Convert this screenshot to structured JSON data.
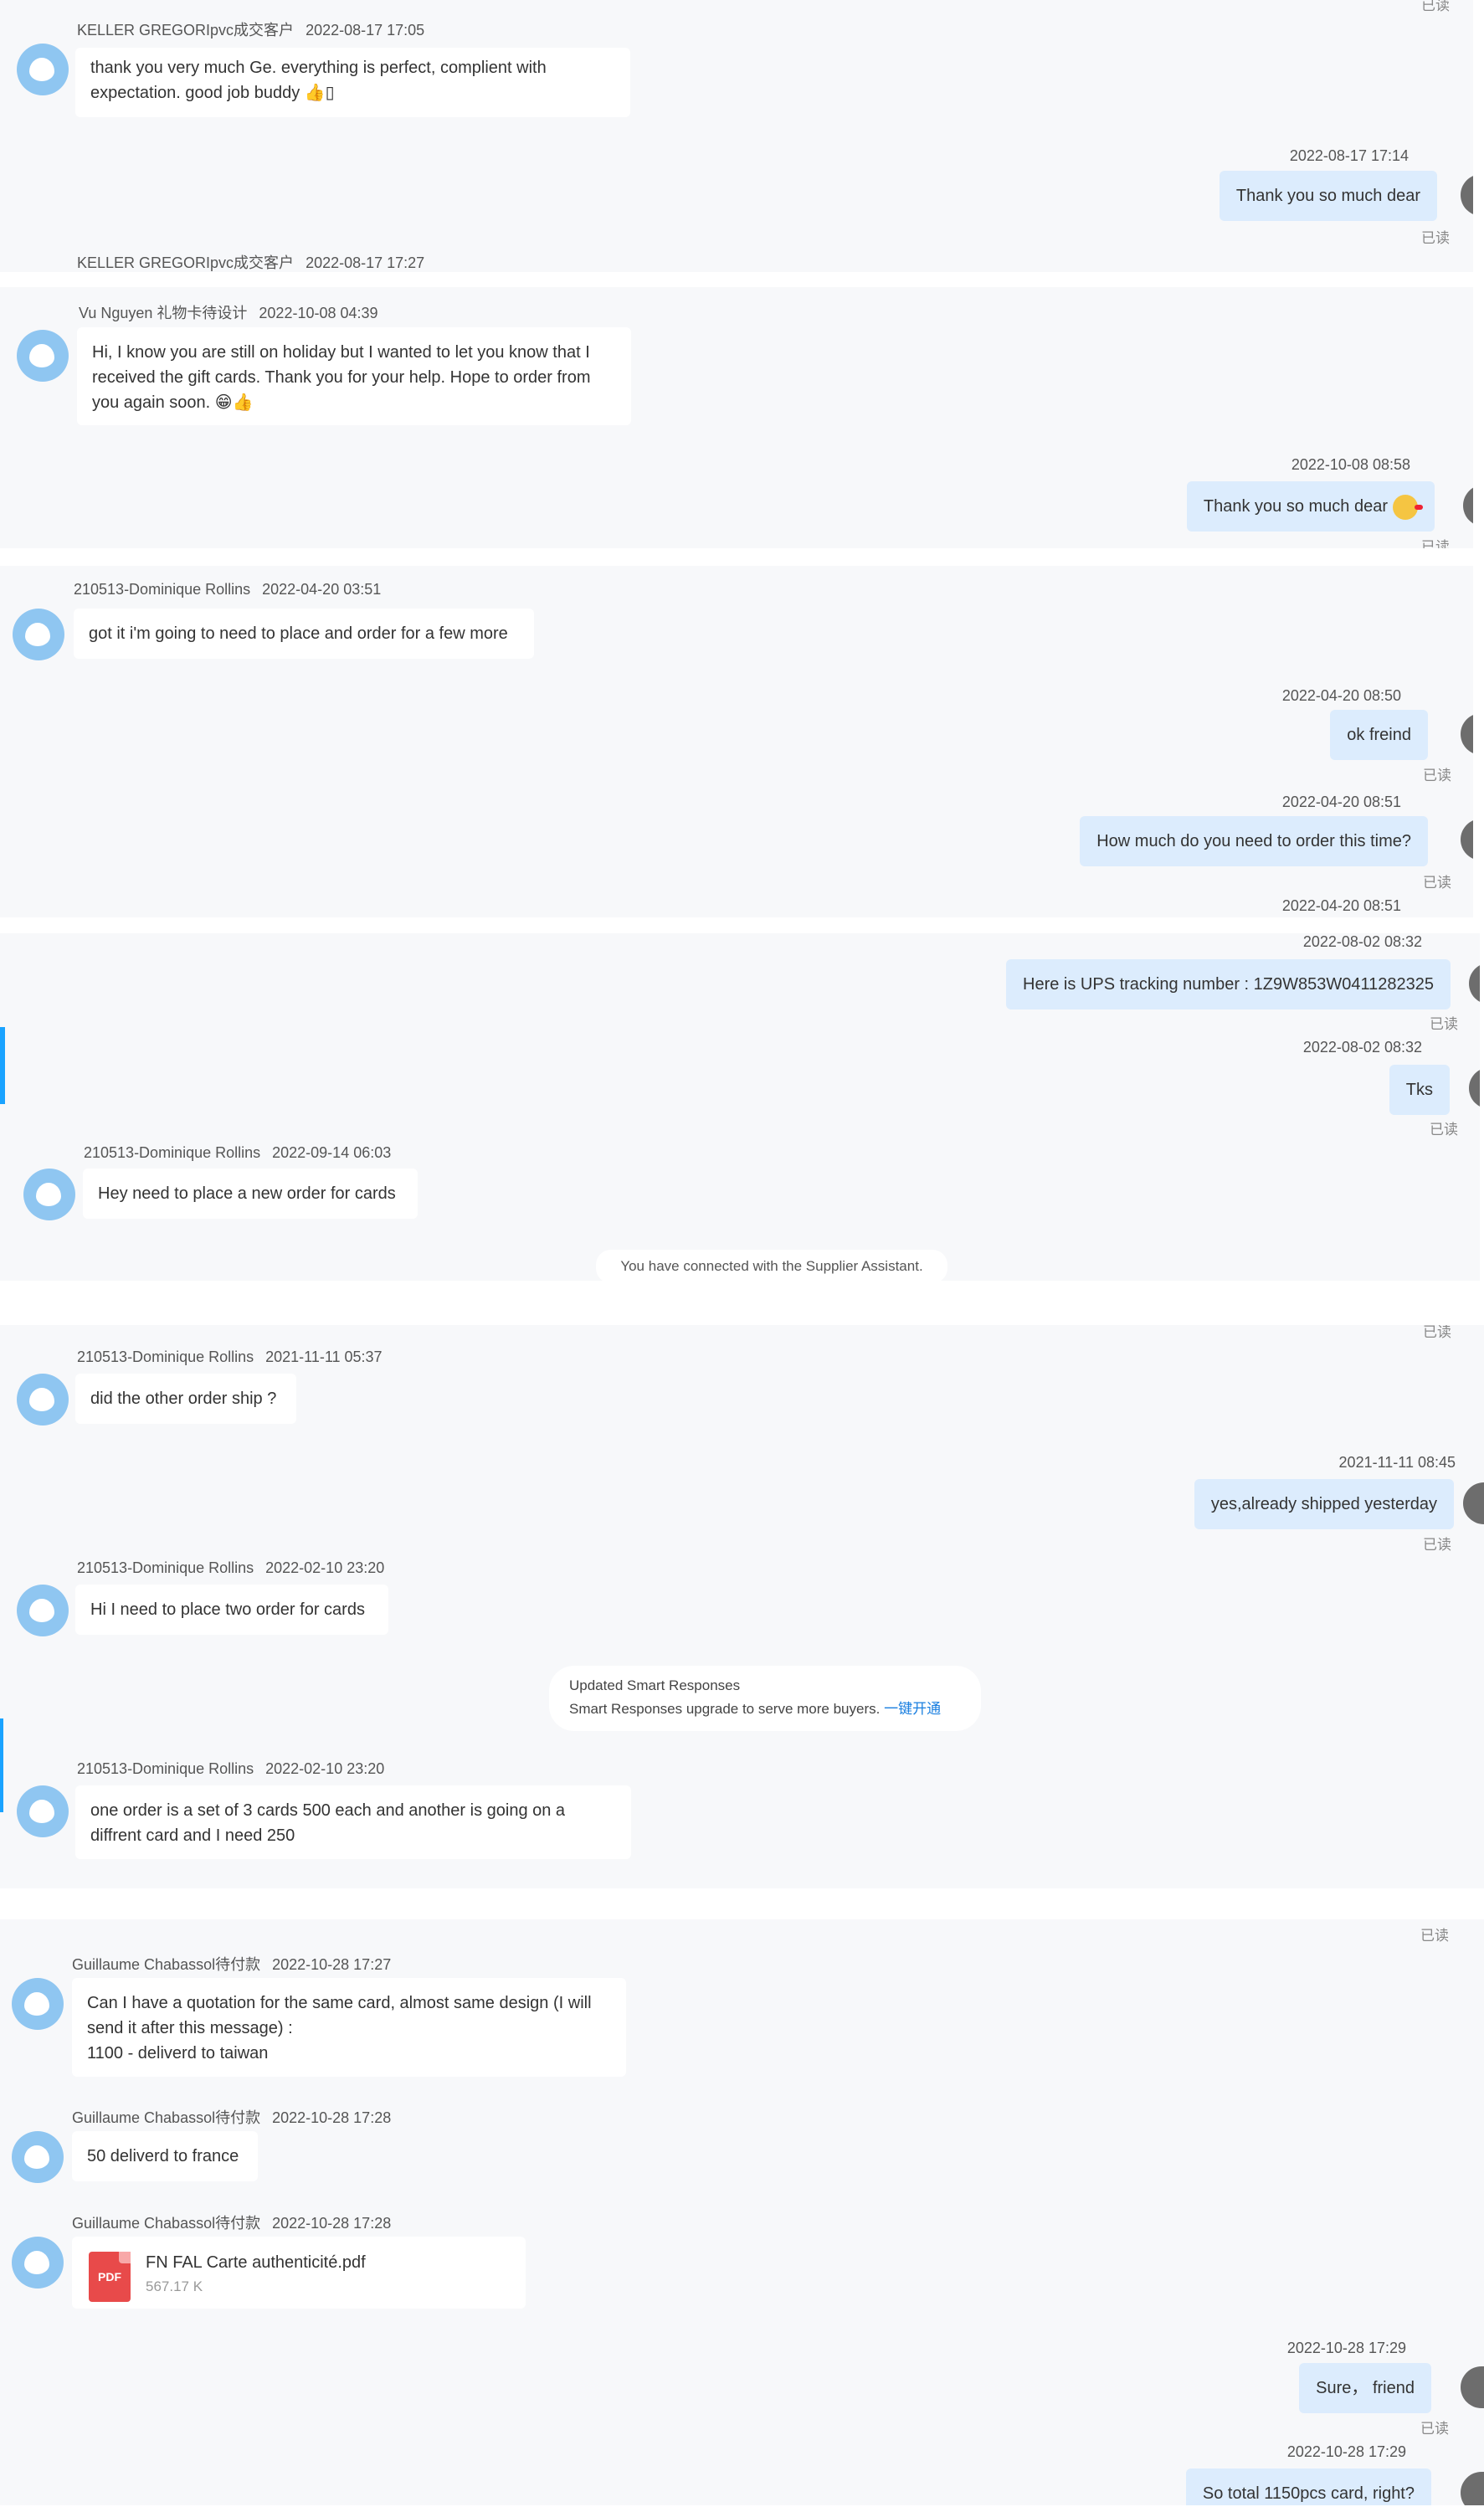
{
  "read_label": "已读",
  "s1": {
    "m1": {
      "sender": "KELLER GREGORIpvc成交客户",
      "time": "2022-08-17 17:05",
      "text": "thank you very much Ge. everything is perfect, complient with expectation. good job buddy 👍▯"
    },
    "m2": {
      "time": "2022-08-17 17:14",
      "text": "Thank you so much dear"
    },
    "m3": {
      "sender": "KELLER GREGORIpvc成交客户",
      "time": "2022-08-17 17:27"
    }
  },
  "s2": {
    "m1": {
      "sender": "Vu Nguyen 礼物卡待设计",
      "time": "2022-10-08 04:39",
      "text": "Hi, I know you are still on holiday but I wanted to let you know that I received the gift cards. Thank you for your help. Hope to order from you again soon. 😁👍"
    },
    "m2": {
      "time": "2022-10-08 08:58",
      "text": "Thank you so much dear",
      "emoji": "cheers-emoji"
    }
  },
  "s3": {
    "m1": {
      "sender": "210513-Dominique Rollins",
      "time": "2022-04-20 03:51",
      "text": "got it i'm going to need to place and order for a few more"
    },
    "m2": {
      "time": "2022-04-20 08:50",
      "text": "ok freind"
    },
    "m3": {
      "time": "2022-04-20 08:51",
      "text": "How much do you need to order this time?"
    },
    "m4": {
      "time": "2022-04-20 08:51"
    }
  },
  "s4": {
    "m1": {
      "time": "2022-08-02 08:32",
      "text": "Here is UPS tracking number : 1Z9W853W0411282325"
    },
    "m2": {
      "time": "2022-08-02 08:32",
      "text": "Tks"
    },
    "m3": {
      "sender": "210513-Dominique Rollins",
      "time": "2022-09-14 06:03",
      "text": "Hey need to place a new order for cards"
    },
    "system": "You have connected with the Supplier Assistant."
  },
  "s5": {
    "m1": {
      "sender": "210513-Dominique Rollins",
      "time": "2021-11-11 05:37",
      "text": "did the other order ship ?"
    },
    "m2": {
      "time": "2021-11-11 08:45",
      "text": "yes,already shipped yesterday"
    },
    "m3": {
      "sender": "210513-Dominique Rollins",
      "time": "2022-02-10 23:20",
      "text": "Hi I need to place two order for cards"
    },
    "smart": {
      "title": "Updated Smart Responses",
      "body": "Smart Responses upgrade to serve more buyers.",
      "link": "一键开通"
    },
    "m4": {
      "sender": "210513-Dominique Rollins",
      "time": "2022-02-10 23:20",
      "text": "one order is a set of 3 cards 500 each and another is going on a diffrent card and I need 250"
    }
  },
  "s6": {
    "m1": {
      "sender": "Guillaume Chabassol待付款",
      "time": "2022-10-28 17:27",
      "lines": [
        "Can I have a quotation for the same card, almost same design (I will send it after this message) :",
        "1100 - deliverd to taiwan"
      ]
    },
    "m2": {
      "sender": "Guillaume Chabassol待付款",
      "time": "2022-10-28 17:28",
      "text": "50 deliverd to france"
    },
    "m3": {
      "sender": "Guillaume Chabassol待付款",
      "time": "2022-10-28 17:28",
      "file": {
        "icon_label": "PDF",
        "name": "FN FAL Carte authenticité.pdf",
        "size": "567.17 K"
      }
    },
    "m4": {
      "time": "2022-10-28 17:29",
      "text": "Sure， friend"
    },
    "m5": {
      "time": "2022-10-28 17:29",
      "text": "So total 1150pcs card, right?"
    }
  }
}
